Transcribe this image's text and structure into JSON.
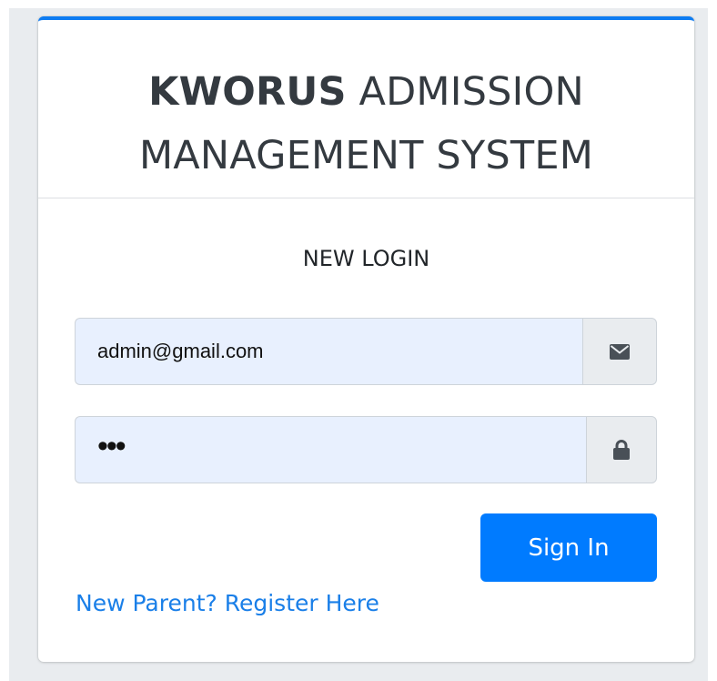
{
  "header": {
    "brand": "KWORUS",
    "title_rest": " ADMISSION",
    "title_line2": "MANAGEMENT SYSTEM"
  },
  "login": {
    "message": "NEW LOGIN",
    "email": {
      "value": "admin@gmail.com",
      "icon": "envelope-icon"
    },
    "password": {
      "value": "•••",
      "icon": "lock-icon"
    },
    "submit_label": "Sign In",
    "register_link": "New Parent? Register Here"
  },
  "colors": {
    "accent": "#007bff",
    "top_border": "#0d7cf2",
    "link": "#1a7fe8",
    "autofill_bg": "#e8f0fe",
    "addon_bg": "#e9ecef"
  }
}
